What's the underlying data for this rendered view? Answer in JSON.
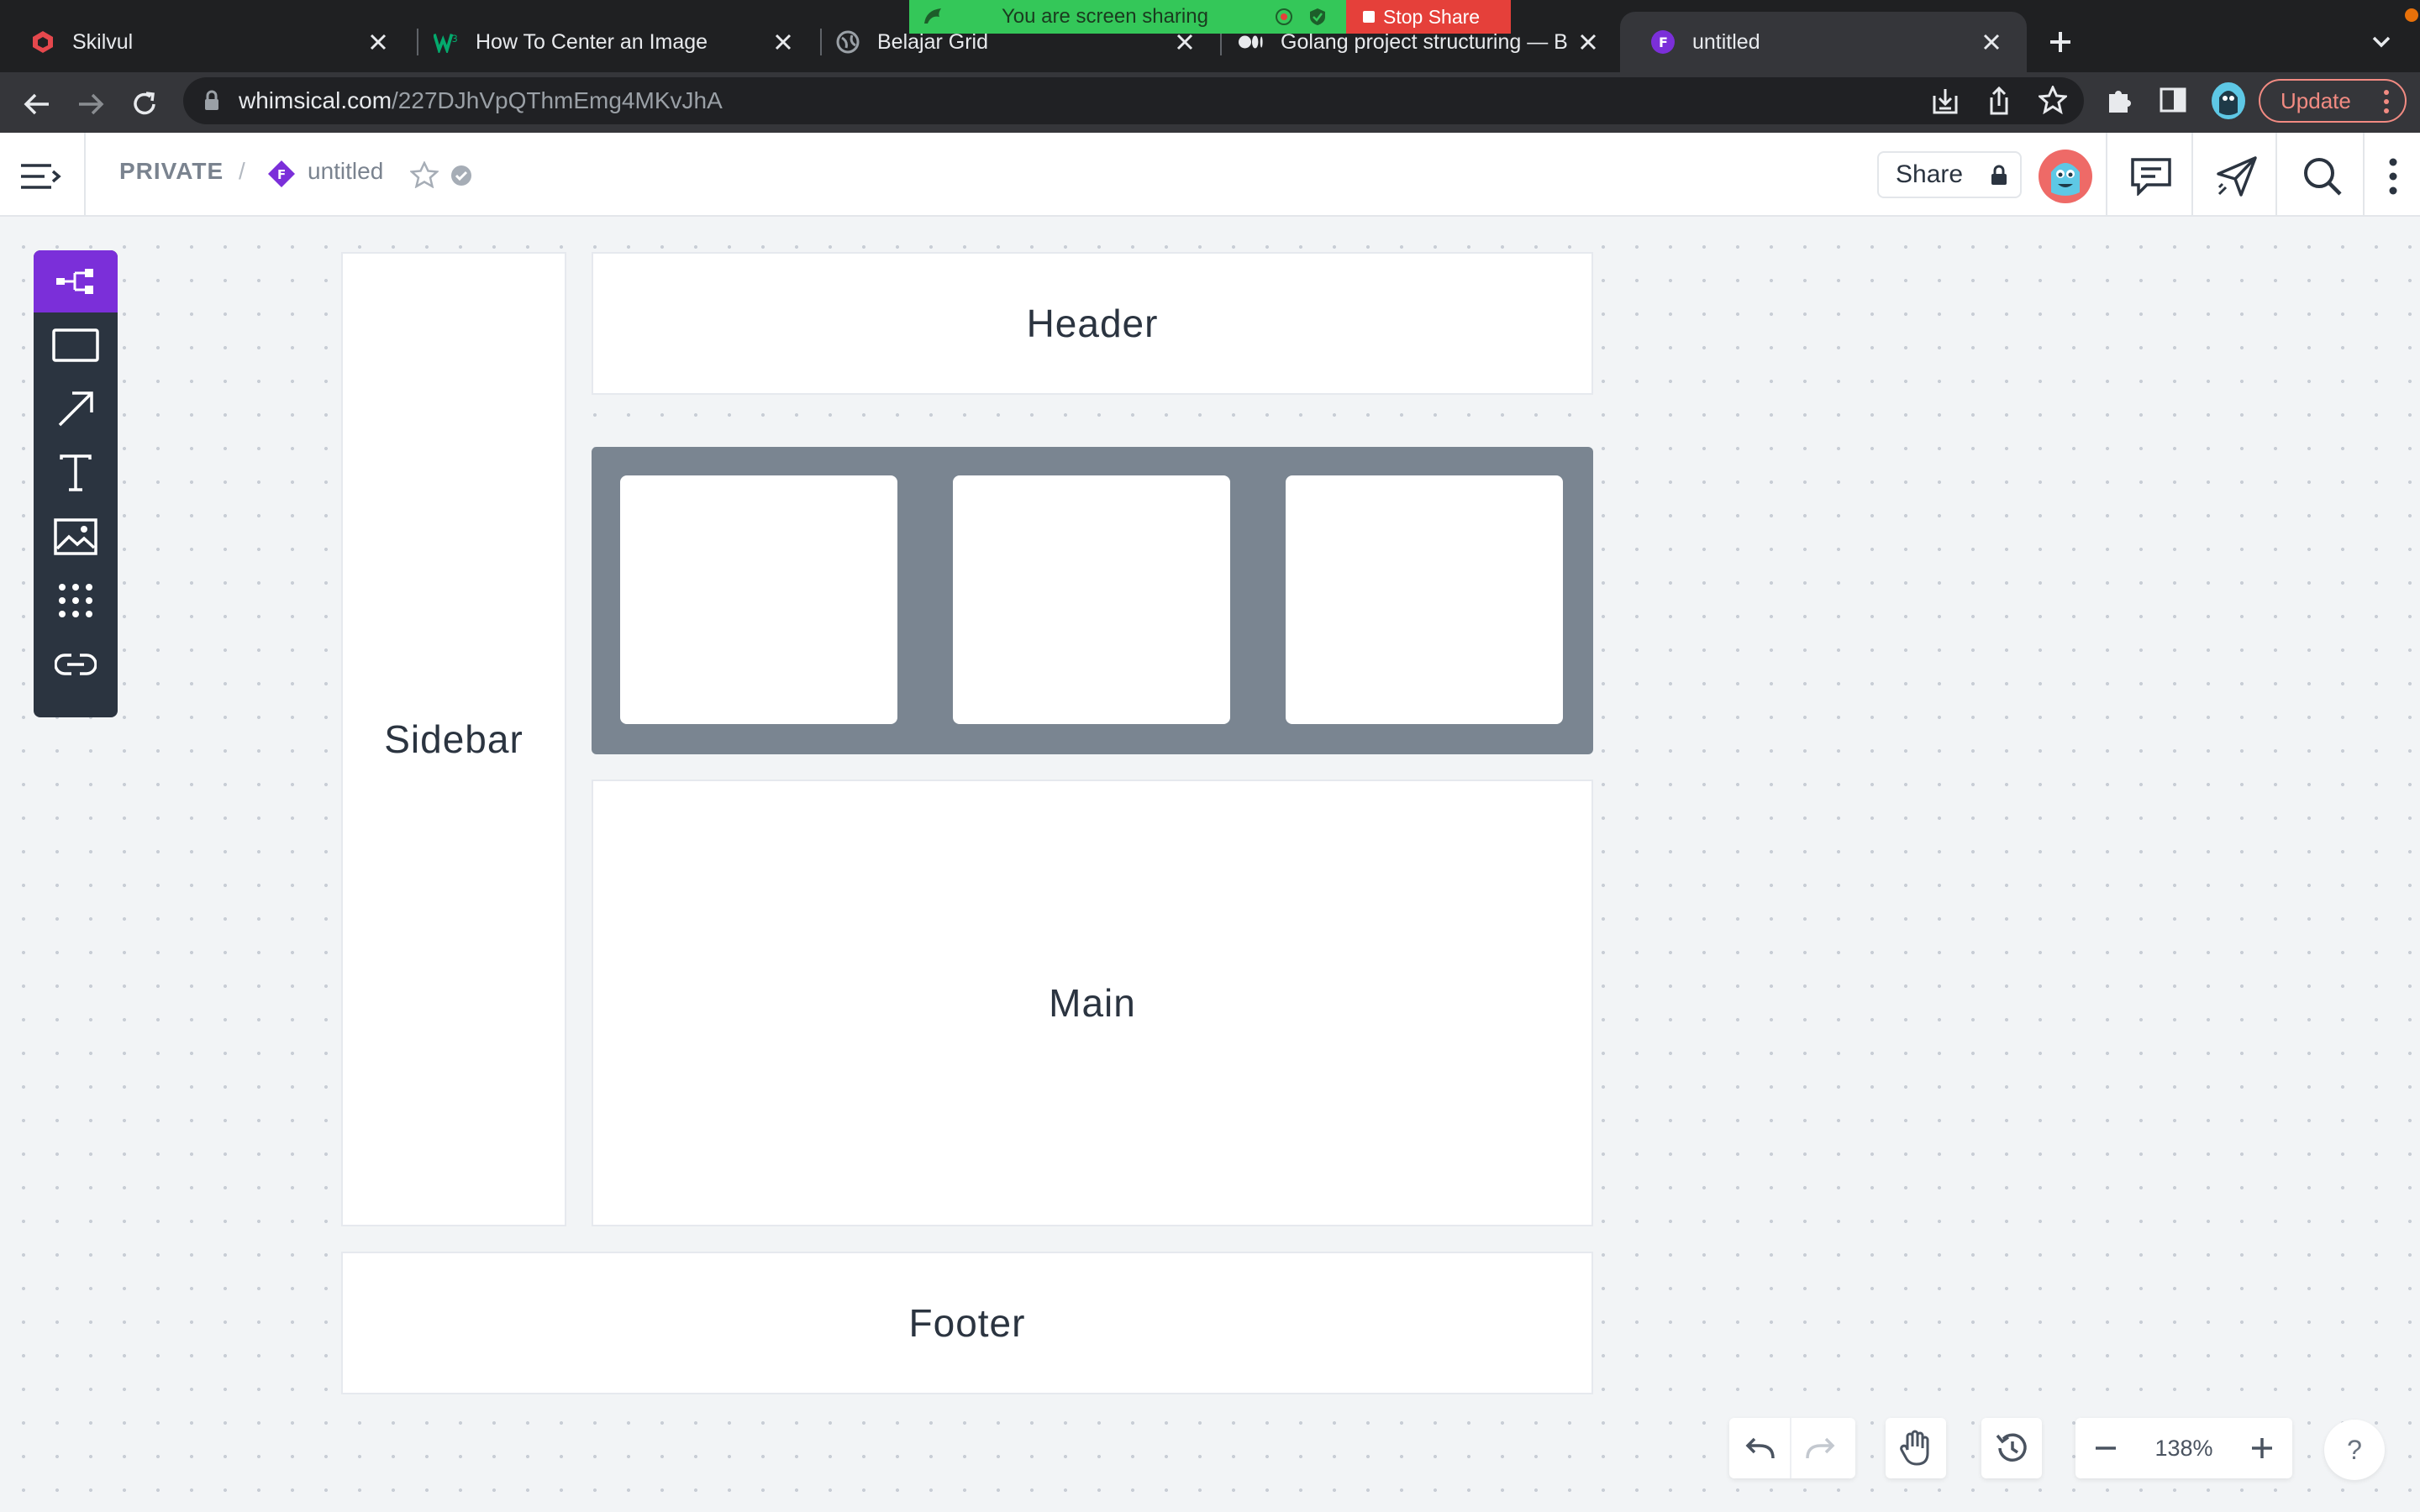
{
  "browser": {
    "tabs": [
      {
        "title": "Skilvul",
        "icon": "skilvul-favicon-icon",
        "active": false
      },
      {
        "title": "How To Center an Image",
        "icon": "w3-favicon-icon",
        "active": false
      },
      {
        "title": "Belajar Grid",
        "icon": "globe-icon",
        "active": false
      },
      {
        "title": "Golang project structuring — B",
        "icon": "medium-favicon-icon",
        "active": false
      },
      {
        "title": "untitled",
        "icon": "whimsical-favicon-icon",
        "active": true
      }
    ],
    "screen_share": {
      "message": "You are screen sharing",
      "stop_label": "Stop Share"
    },
    "url_host": "whimsical.com",
    "url_path": "/227DJhVpQThmEmg4MKvJhA",
    "update_label": "Update",
    "colors": {
      "tabbar": "#1f2022",
      "toolbar": "#35363a",
      "share_green": "#34c759",
      "share_red": "#e5403a"
    }
  },
  "app": {
    "breadcrumb_workspace": "PRIVATE",
    "breadcrumb_separator": "/",
    "doc_title": "untitled",
    "share_label": "Share",
    "accent": "#7b2fd9"
  },
  "canvas": {
    "blocks": {
      "header": "Header",
      "sidebar": "Sidebar",
      "main": "Main",
      "footer": "Footer"
    },
    "grid_cells": 3,
    "grid_color": "#7a8591"
  },
  "tools": [
    "flowchart-icon",
    "rectangle-icon",
    "arrow-icon",
    "text-icon",
    "image-icon",
    "grid-icon",
    "link-icon"
  ],
  "controls": {
    "zoom_level": "138%",
    "help_label": "?"
  }
}
